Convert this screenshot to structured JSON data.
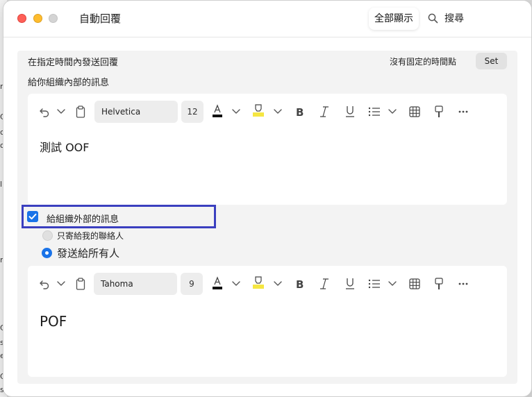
{
  "background_app": {
    "fragments": [
      "n",
      "Cc",
      "c",
      "or",
      "l",
      "n",
      "Cc",
      "s.",
      "e",
      "Cc",
      "s..."
    ]
  },
  "window": {
    "title": "自動回覆",
    "show_all": "全部顯示",
    "search_label": "搜尋"
  },
  "schedule": {
    "label": "在指定時間內發送回覆",
    "no_fixed_time": "沒有固定的時間點",
    "set_button": "Set"
  },
  "internal": {
    "label": "給你組織內部的訊息",
    "font": "Helvetica",
    "size": "12",
    "body": "測試 OOF"
  },
  "external": {
    "checkbox_label": "給組織外部的訊息",
    "checked": true,
    "option_contacts": "只寄給我的聯絡人",
    "option_everyone": "發送給所有人",
    "font": "Tahoma",
    "size": "9",
    "body": "POF"
  },
  "colors": {
    "accent": "#1a73e8",
    "highlight_box": "#3a3fbf",
    "highlighter": "#f5e642"
  }
}
